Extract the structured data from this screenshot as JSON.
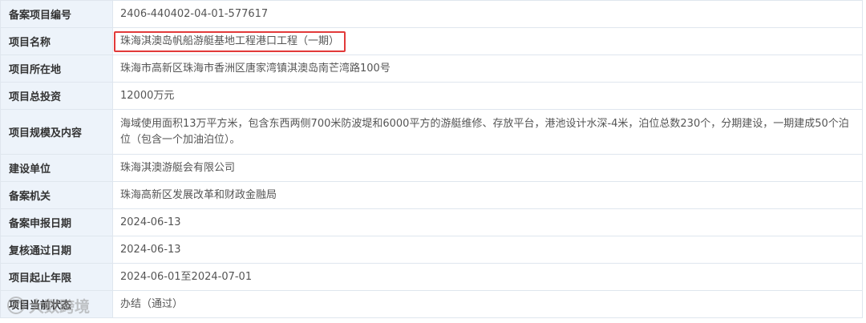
{
  "rows": [
    {
      "label": "备案项目编号",
      "value": "2406-440402-04-01-577617"
    },
    {
      "label": "项目名称",
      "value": "珠海淇澳岛帆船游艇基地工程港口工程（一期）"
    },
    {
      "label": "项目所在地",
      "value": "珠海市高新区珠海市香洲区唐家湾镇淇澳岛南芒湾路100号"
    },
    {
      "label": "项目总投资",
      "value": "12000万元"
    },
    {
      "label": "项目规模及内容",
      "value": "海域使用面积13万平方米，包含东西两侧700米防波堤和6000平方的游艇维修、存放平台，港池设计水深-4米，泊位总数230个，分期建设，一期建成50个泊位（包含一个加油泊位）。"
    },
    {
      "label": "建设单位",
      "value": "珠海淇澳游艇会有限公司"
    },
    {
      "label": "备案机关",
      "value": "珠海高新区发展改革和财政金融局"
    },
    {
      "label": "备案申报日期",
      "value": "2024-06-13"
    },
    {
      "label": "复核通过日期",
      "value": "2024-06-13"
    },
    {
      "label": "项目起止年限",
      "value": "2024-06-01至2024-07-01"
    },
    {
      "label": "项目当前状态",
      "value": "办结（通过）"
    }
  ],
  "watermark": {
    "text": "大数跨境"
  },
  "colors": {
    "label_bg": "#edf3fa",
    "border": "#dfe6ee",
    "highlight": "#e23a3a"
  }
}
